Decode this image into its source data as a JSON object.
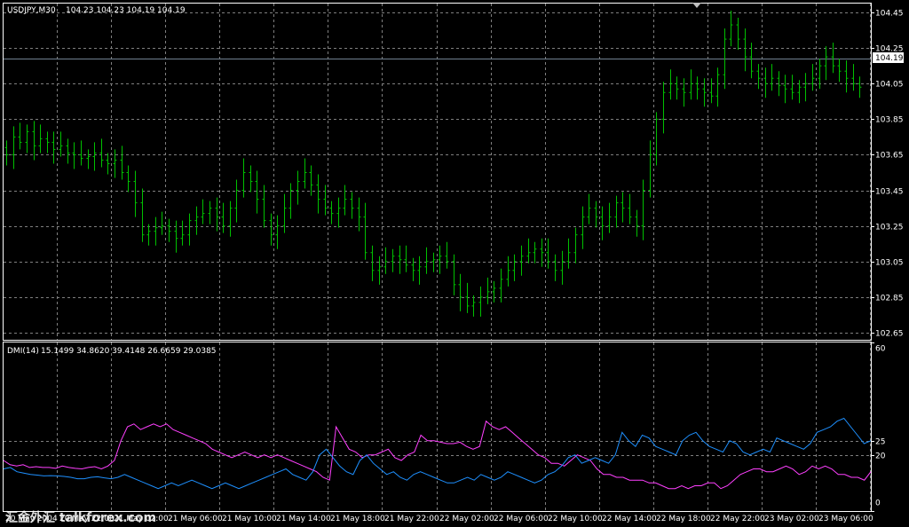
{
  "header": {
    "symbol": "USDJPY,M30",
    "ohlc": "104.23 104.23 104.19 104.19"
  },
  "indicator": {
    "label": "DMI(14)",
    "values": "15.1499 34.8620 39.4148 26.6659 29.0385"
  },
  "watermark": "汇金外汇 talkforex.com",
  "colors": {
    "background": "#000000",
    "grid": "#7f7f7f",
    "bars": "#00c000",
    "plus_di": "#ff40ff",
    "minus_di": "#1e90ff",
    "price_line": "#708090"
  },
  "chart_data": [
    {
      "type": "ohlc",
      "title": "USDJPY,M30",
      "yticks": [
        "104.45",
        "104.25",
        "104.05",
        "103.85",
        "103.65",
        "103.45",
        "103.25",
        "103.05",
        "102.85",
        "102.65"
      ],
      "ylim": [
        102.61,
        104.5
      ],
      "current_price": "104.19",
      "xticks": [
        "20 May 2004",
        "20 May 22:00",
        "21 May 02:00",
        "21 May 06:00",
        "21 May 10:00",
        "21 May 14:00",
        "21 May 18:00",
        "21 May 22:00",
        "22 May 02:00",
        "22 May 06:00",
        "22 May 10:00",
        "22 May 14:00",
        "22 May 18:00",
        "22 May 22:00",
        "23 May 02:00",
        "23 May 06:00"
      ],
      "closes": [
        103.65,
        103.75,
        103.72,
        103.78,
        103.7,
        103.74,
        103.72,
        103.68,
        103.7,
        103.66,
        103.65,
        103.63,
        103.64,
        103.66,
        103.62,
        103.6,
        103.62,
        103.55,
        103.5,
        103.38,
        103.2,
        103.22,
        103.24,
        103.25,
        103.22,
        103.18,
        103.2,
        103.28,
        103.3,
        103.32,
        103.35,
        103.3,
        103.25,
        103.35,
        103.45,
        103.55,
        103.5,
        103.4,
        103.28,
        103.2,
        103.25,
        103.35,
        103.45,
        103.5,
        103.55,
        103.48,
        103.4,
        103.35,
        103.32,
        103.35,
        103.4,
        103.35,
        103.3,
        103.1,
        103.0,
        103.02,
        103.05,
        103.08,
        103.06,
        103.03,
        103.0,
        103.02,
        103.05,
        103.06,
        103.08,
        103.05,
        102.92,
        102.85,
        102.8,
        102.82,
        102.85,
        102.88,
        102.9,
        102.95,
        103.0,
        103.05,
        103.08,
        103.1,
        103.12,
        103.1,
        103.05,
        103.0,
        103.05,
        103.1,
        103.2,
        103.3,
        103.35,
        103.3,
        103.25,
        103.3,
        103.38,
        103.35,
        103.3,
        103.25,
        103.45,
        103.65,
        103.85,
        104.0,
        104.05,
        104.02,
        104.0,
        104.05,
        104.02,
        104.0,
        103.98,
        104.1,
        104.3,
        104.38,
        104.3,
        104.2,
        104.12,
        104.08,
        104.05,
        104.08,
        104.04,
        104.02,
        104.0,
        104.03,
        104.05,
        104.08,
        104.15,
        104.2,
        104.15,
        104.12,
        104.08,
        104.05,
        104.03
      ]
    },
    {
      "type": "line",
      "title": "DMI(14)",
      "yticks": [
        "60",
        "25",
        "20",
        "0"
      ],
      "ylim": [
        0,
        60
      ],
      "series": [
        {
          "color": "#ff40ff",
          "values": [
            18,
            16.5,
            16,
            16.5,
            15.5,
            15.8,
            15.5,
            15.5,
            15.2,
            16,
            15.5,
            15.2,
            15,
            15.5,
            15.8,
            15,
            16,
            18,
            25,
            30,
            31,
            29,
            30,
            31,
            30,
            31,
            29,
            28,
            27,
            26,
            25,
            24,
            22,
            21,
            20,
            19,
            20,
            21,
            20,
            19,
            20,
            19,
            20,
            19,
            18,
            17,
            16,
            15,
            14,
            12,
            11,
            30,
            26,
            22,
            21,
            19,
            20,
            20,
            21,
            22,
            19,
            18,
            20,
            21,
            27,
            25,
            25,
            24.5,
            24,
            24,
            24.5,
            23,
            22,
            23,
            32,
            30,
            29,
            30,
            28,
            26,
            24,
            22,
            20,
            19,
            17,
            17,
            16,
            18,
            20,
            19,
            18,
            15,
            13,
            13,
            12,
            12,
            11,
            11,
            11,
            10,
            10,
            9,
            8,
            8,
            9,
            8,
            9,
            9,
            10,
            10,
            8,
            9,
            11,
            13,
            14,
            15,
            15,
            14,
            14,
            15,
            16,
            15,
            13,
            14,
            16,
            15,
            16,
            15,
            13,
            13,
            12,
            12,
            11,
            14
          ]
        },
        {
          "color": "#1e90ff",
          "values": [
            15,
            15.5,
            14,
            13.5,
            13,
            12.8,
            12.5,
            12.6,
            12.5,
            12.3,
            12,
            11.5,
            11.5,
            12,
            12.2,
            11.8,
            11.5,
            12,
            13,
            12,
            11,
            10,
            9,
            8,
            9,
            10,
            9,
            10,
            11,
            10,
            9,
            8,
            9,
            10,
            9,
            8,
            9,
            10,
            11,
            12,
            13,
            14,
            15,
            13,
            12,
            11,
            14,
            20,
            22,
            19,
            16,
            14,
            13,
            18,
            20,
            17,
            15,
            13,
            14,
            12,
            11,
            13,
            14,
            13,
            12,
            11,
            10,
            10,
            11,
            12,
            11,
            13,
            12,
            11,
            12,
            14,
            13,
            12,
            11,
            10,
            11,
            13,
            14,
            16,
            19,
            20,
            17,
            18,
            19,
            18,
            17,
            20,
            28,
            25,
            23,
            27,
            26,
            23,
            22,
            21,
            20,
            25,
            27,
            28,
            25,
            23,
            22,
            21,
            25,
            24,
            21,
            20,
            21,
            22,
            21,
            26,
            25,
            24,
            23,
            22,
            24,
            28,
            29,
            30,
            32,
            33,
            30,
            27,
            24,
            25
          ]
        }
      ]
    }
  ]
}
